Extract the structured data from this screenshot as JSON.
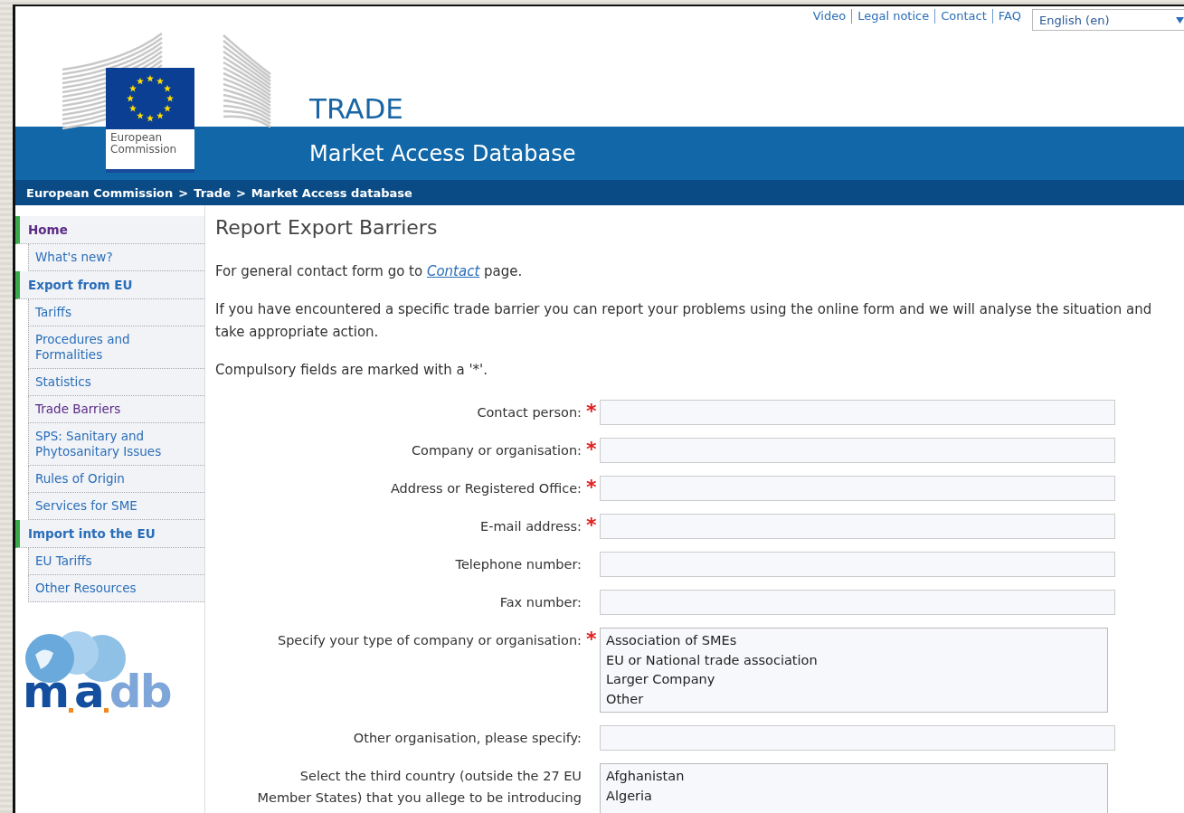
{
  "top_links": [
    "Video",
    "Legal notice",
    "Contact",
    "FAQ"
  ],
  "language": {
    "value": "English (en)"
  },
  "logo": {
    "line_1": "European",
    "line_2": "Commission"
  },
  "site": {
    "title": "TRADE",
    "subtitle": "Market Access Database"
  },
  "breadcrumb": [
    "European Commission",
    "Trade",
    "Market Access database"
  ],
  "breadcrumb_separator": ">",
  "sidebar": {
    "items": [
      {
        "kind": "section",
        "label": "Home",
        "visited": true
      },
      {
        "kind": "link",
        "label": "What's new?",
        "visited": false
      },
      {
        "kind": "section",
        "label": "Export from EU",
        "visited": false
      },
      {
        "kind": "link",
        "label": "Tariffs",
        "visited": false
      },
      {
        "kind": "link",
        "label": "Procedures and Formalities",
        "visited": false
      },
      {
        "kind": "link",
        "label": "Statistics",
        "visited": false
      },
      {
        "kind": "link",
        "label": "Trade Barriers",
        "visited": true
      },
      {
        "kind": "link",
        "label": "SPS: Sanitary and Phytosanitary Issues",
        "visited": false
      },
      {
        "kind": "link",
        "label": "Rules of Origin",
        "visited": false
      },
      {
        "kind": "link",
        "label": "Services for SME",
        "visited": false
      },
      {
        "kind": "section",
        "label": "Import into the EU",
        "visited": false
      },
      {
        "kind": "link",
        "label": "EU Tariffs",
        "visited": false
      },
      {
        "kind": "link",
        "label": "Other Resources",
        "visited": false
      }
    ],
    "brand_parts": [
      "m",
      "a",
      "db"
    ]
  },
  "page": {
    "title": "Report Export Barriers",
    "contact_before": "For general contact form go to",
    "contact_link": "Contact",
    "contact_after": "page.",
    "intro": "If you have encountered a specific trade barrier you can report your problems using the online form and we will analyse the situation and take appropriate action.",
    "compulsory_note": "Compulsory fields are marked with a '*'.",
    "required_mark": "*"
  },
  "form": [
    {
      "kind": "text",
      "label": "Contact person:",
      "required": true
    },
    {
      "kind": "text",
      "label": "Company or organisation:",
      "required": true
    },
    {
      "kind": "text",
      "label": "Address or Registered Office:",
      "required": true
    },
    {
      "kind": "text",
      "label": "E-mail address:",
      "required": true
    },
    {
      "kind": "text",
      "label": "Telephone number:",
      "required": false
    },
    {
      "kind": "text",
      "label": "Fax number:",
      "required": false
    },
    {
      "kind": "listbox",
      "label": "Specify your type of company or organisation:",
      "required": true,
      "options": [
        "Association of SMEs",
        "EU or National trade association",
        "Larger Company",
        "Other"
      ]
    },
    {
      "kind": "text",
      "label": "Other organisation, please specify:",
      "required": false
    },
    {
      "kind": "listbox",
      "label": "Select the third country (outside the 27 EU\nMember States) that you allege to be introducing",
      "required": false,
      "options": [
        "Afghanistan",
        "Algeria"
      ]
    }
  ]
}
